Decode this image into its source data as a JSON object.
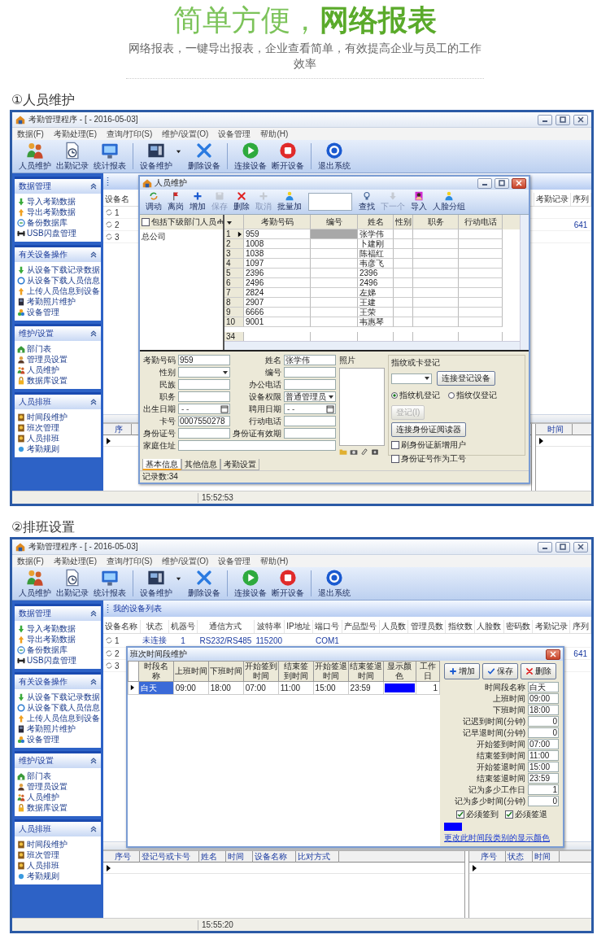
{
  "header": {
    "title_light": "简单方便，",
    "title_bold": "网络报表",
    "subtitle": "网络报表，一键导出报表，企业查看简单，有效提高企业与员工的工作效率"
  },
  "sections": [
    {
      "label": "①人员维护",
      "app": {
        "title": "考勤管理程序 - [ - 2016-05-03]",
        "menu": [
          "数据(F)",
          "考勤处理(E)",
          "查询/打印(S)",
          "维护/设置(O)",
          "设备管理",
          "帮助(H)"
        ],
        "toolbar": [
          [
            {
              "label": "人员维护",
              "dropdown": false
            },
            {
              "label": "出勤记录",
              "dropdown": false
            },
            {
              "label": "统计报表",
              "dropdown": false
            }
          ],
          [
            {
              "label": "设备维护",
              "dropdown": true
            },
            {
              "label": "删除设备",
              "dropdown": false
            }
          ],
          [
            {
              "label": "连接设备",
              "dropdown": false
            },
            {
              "label": "断开设备",
              "dropdown": false
            }
          ],
          [
            {
              "label": "退出系统",
              "dropdown": false
            }
          ]
        ],
        "sidebar": [
          {
            "title": "数据管理",
            "expanded": true,
            "items": [
              "导入考勤数据",
              "导出考勤数据",
              "备份数据库",
              "USB闪盘管理"
            ]
          },
          {
            "title": "有关设备操作",
            "expanded": true,
            "items": [
              "从设备下载记录数据",
              "从设备下载人员信息",
              "上传人员信息到设备",
              "考勤照片维护",
              "设备管理"
            ]
          },
          {
            "title": "维护/设置",
            "expanded": true,
            "items": [
              "部门表",
              "管理员设置",
              "人员维护",
              "数据库设置"
            ]
          },
          {
            "title": "人员排班",
            "expanded": true,
            "items": [
              "时间段维护",
              "班次管理",
              "人员排班",
              "考勤规则"
            ]
          }
        ],
        "devices": {
          "columns": [
            "设备名",
            "考勤记录",
            "序列"
          ],
          "rows": [
            [
              "1"
            ],
            [
              "2",
              null,
              "641"
            ],
            [
              "3"
            ]
          ]
        },
        "log": {
          "columns": [
            "序"
          ],
          "side_columns": [
            "时间"
          ]
        },
        "status_time": "15:52:53"
      },
      "dialog": {
        "kind": "staff",
        "title": "人员维护",
        "toolbar": [
          [
            {
              "label": "调动",
              "disabled": false
            },
            {
              "label": "离岗",
              "disabled": false
            },
            {
              "label": "增加",
              "disabled": false
            },
            {
              "label": "保存",
              "disabled": true
            },
            {
              "label": "删除",
              "disabled": false
            },
            {
              "label": "取消",
              "disabled": true
            },
            {
              "label": "批量加",
              "disabled": false
            }
          ],
          [
            {
              "label": "查找",
              "disabled": false
            },
            {
              "label": "下一个",
              "disabled": true
            },
            {
              "label": "导入",
              "disabled": false
            },
            {
              "label": "人脸分组",
              "disabled": false
            }
          ]
        ],
        "tree": {
          "include_sub": {
            "label": "包括下级部门人员",
            "checked": false
          },
          "nodes": [
            "总公司"
          ]
        },
        "grid": {
          "columns": [
            "考勤号码",
            "编号",
            "姓名",
            "性别",
            "职务",
            "行动电话"
          ],
          "rows": [
            {
              "n": "1",
              "cells": [
                "959",
                null,
                "张学伟"
              ],
              "selected": true
            },
            {
              "n": "2",
              "cells": [
                "1008",
                null,
                "卜建刚"
              ],
              "selected": false
            },
            {
              "n": "3",
              "cells": [
                "1038",
                null,
                "陈福红"
              ],
              "selected": false
            },
            {
              "n": "4",
              "cells": [
                "1097",
                null,
                "韦彦飞"
              ],
              "selected": false
            },
            {
              "n": "5",
              "cells": [
                "2396",
                null,
                "2396"
              ],
              "selected": false
            },
            {
              "n": "6",
              "cells": [
                "2496",
                null,
                "2496"
              ],
              "selected": false
            },
            {
              "n": "7",
              "cells": [
                "2824",
                null,
                "左娣"
              ],
              "selected": false
            },
            {
              "n": "8",
              "cells": [
                "2907",
                null,
                "王建"
              ],
              "selected": false
            },
            {
              "n": "9",
              "cells": [
                "6666",
                null,
                "王荣"
              ],
              "selected": false
            },
            {
              "n": "10",
              "cells": [
                "9001",
                null,
                "韦惠琴"
              ],
              "selected": false
            }
          ],
          "footer_number": "34"
        },
        "form": {
          "left": [
            {
              "label": "考勤号码",
              "kind": "text",
              "value": "959"
            },
            {
              "label": "性别",
              "kind": "select"
            },
            {
              "label": "民族",
              "kind": "text"
            },
            {
              "label": "职务",
              "kind": "text"
            },
            {
              "label": "出生日期",
              "kind": "date",
              "placeholder": "- -"
            },
            {
              "label": "卡号",
              "kind": "text",
              "value": "0007550278"
            },
            {
              "label": "身份证号",
              "kind": "text"
            }
          ],
          "right": [
            {
              "label": "姓名",
              "kind": "text",
              "value": "张学伟"
            },
            {
              "label": "编号",
              "kind": "text"
            },
            {
              "label": "办公电话",
              "kind": "text"
            },
            {
              "label": "设备权限",
              "kind": "select",
              "value": "普通管理员"
            },
            {
              "label": "聘用日期",
              "kind": "date",
              "placeholder": "- -"
            },
            {
              "label": "行动电话",
              "kind": "text"
            },
            {
              "label": "身份证有效期",
              "kind": "text"
            }
          ],
          "address": "家庭住址"
        },
        "photo": "照片",
        "enroll": {
          "title": "指纹或卡登记",
          "connect": "连接登记设备",
          "radios": [
            {
              "label": "指纹机登记",
              "selected": true
            },
            {
              "label": "指纹仪登记",
              "selected": false
            }
          ],
          "register": {
            "label": "登记(I)",
            "disabled": true
          },
          "id_reader": "连接身份证阅读器",
          "checks": [
            {
              "label": "刷身份证新增用户",
              "checked": false
            },
            {
              "label": "身份证号作为工号",
              "checked": false
            }
          ]
        },
        "tabs": [
          {
            "label": "基本信息",
            "selected": true
          },
          {
            "label": "其他信息",
            "selected": false
          },
          {
            "label": "考勤设置",
            "selected": false
          }
        ],
        "status": "记录数:34"
      }
    },
    {
      "label": "②排班设置",
      "app": {
        "title": "考勤管理程序 - [ - 2016-05-03]",
        "menu": [
          "数据(F)",
          "考勤处理(E)",
          "查询/打印(S)",
          "维护/设置(O)",
          "设备管理",
          "帮助(H)"
        ],
        "toolbar": [
          [
            {
              "label": "人员维护",
              "dropdown": false
            },
            {
              "label": "出勤记录",
              "dropdown": false
            },
            {
              "label": "统计报表",
              "dropdown": false
            }
          ],
          [
            {
              "label": "设备维护",
              "dropdown": true
            },
            {
              "label": "删除设备",
              "dropdown": false
            }
          ],
          [
            {
              "label": "连接设备",
              "dropdown": false
            },
            {
              "label": "断开设备",
              "dropdown": false
            }
          ],
          [
            {
              "label": "退出系统",
              "dropdown": false
            }
          ]
        ],
        "sidebar": [
          {
            "title": "数据管理",
            "expanded": true,
            "items": [
              "导入考勤数据",
              "导出考勤数据",
              "备份数据库",
              "USB闪盘管理"
            ]
          },
          {
            "title": "有关设备操作",
            "expanded": true,
            "items": [
              "从设备下载记录数据",
              "从设备下载人员信息",
              "上传人员信息到设备",
              "考勤照片维护",
              "设备管理"
            ]
          },
          {
            "title": "维护/设置",
            "expanded": true,
            "items": [
              "部门表",
              "管理员设置",
              "人员维护",
              "数据库设置"
            ]
          },
          {
            "title": "人员排班",
            "expanded": true,
            "items": [
              "时间段维护",
              "班次管理",
              "人员排班",
              "考勤规则"
            ]
          }
        ],
        "tab_title": "我的设备列表",
        "devices": {
          "columns": [
            "设备名称",
            "状态",
            "机器号",
            "通信方式",
            "波特率",
            "IP地址",
            "端口号",
            "产品型号",
            "人员数",
            "管理员数",
            "指纹数",
            "人脸数",
            "密码数",
            "考勤记录",
            "序列"
          ],
          "rows": [
            [
              "1",
              "未连接",
              "1",
              "RS232/RS485",
              "115200",
              null,
              "COM1"
            ],
            [
              "2",
              null,
              null,
              null,
              null,
              null,
              null,
              null,
              null,
              null,
              null,
              null,
              null,
              null,
              "641"
            ],
            [
              "3"
            ]
          ]
        },
        "log": {
          "columns": [
            "序号",
            "登记号或卡号",
            "姓名",
            "时间",
            "设备名称",
            "比对方式"
          ],
          "side_columns": [
            "序号",
            "状态",
            "时间"
          ]
        },
        "status_time": "15:55:20"
      },
      "dialog": {
        "kind": "shift",
        "title": "班次时间段维护",
        "grid": {
          "columns": [
            {
              "label": "时段名称",
              "kind": "text"
            },
            {
              "label": "上班时间",
              "kind": "text"
            },
            {
              "label": "下班时间",
              "kind": "text"
            },
            {
              "label": "开始签到时间",
              "kind": "text"
            },
            {
              "label": "结束签到时间",
              "kind": "text"
            },
            {
              "label": "开始签退时间",
              "kind": "text"
            },
            {
              "label": "结束签退时间",
              "kind": "text"
            },
            {
              "label": "显示颜色",
              "kind": "color"
            },
            {
              "label": "工作日",
              "kind": "number"
            }
          ],
          "rows": [
            {
              "cells": [
                "白天",
                "09:00",
                "18:00",
                "07:00",
                "11:00",
                "15:00",
                "23:59",
                null,
                "1"
              ],
              "color": "#0000ff",
              "selected": true
            }
          ]
        },
        "buttons": [
          "增加",
          "保存",
          "删除"
        ],
        "fields": [
          {
            "label": "时间段名称",
            "value": "白天",
            "kind": "text"
          },
          {
            "label": "上班时间",
            "value": "09:00",
            "kind": "text"
          },
          {
            "label": "下班时间",
            "value": "18:00",
            "kind": "text"
          },
          {
            "label": "记迟到时间(分钟)",
            "value": "0",
            "kind": "number"
          },
          {
            "label": "记早退时间(分钟)",
            "value": "0",
            "kind": "number"
          },
          {
            "label": "开始签到时间",
            "value": "07:00",
            "kind": "text"
          },
          {
            "label": "结束签到时间",
            "value": "11:00",
            "kind": "text"
          },
          {
            "label": "开始签退时间",
            "value": "15:00",
            "kind": "text"
          },
          {
            "label": "结束签退时间",
            "value": "23:59",
            "kind": "text"
          },
          {
            "label": "记为多少工作日",
            "value": "1",
            "kind": "number"
          },
          {
            "label": "记为多少时间(分钟)",
            "value": "0",
            "kind": "number"
          }
        ],
        "checks": [
          {
            "label": "必须签到",
            "checked": true
          },
          {
            "label": "必须签退",
            "checked": true
          }
        ],
        "color_link": {
          "color": "#0000ff",
          "label": "更改此时间段类别的显示颜色"
        }
      }
    }
  ]
}
